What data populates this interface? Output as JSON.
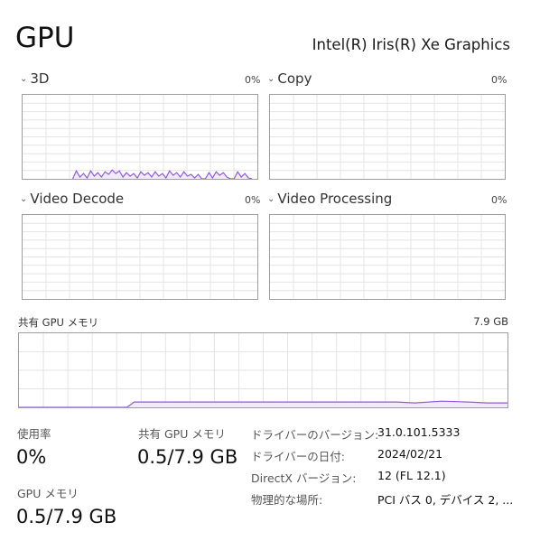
{
  "header": {
    "title": "GPU",
    "adapter": "Intel(R) Iris(R) Xe Graphics"
  },
  "engines": [
    {
      "label": "3D",
      "percent": "0%"
    },
    {
      "label": "Copy",
      "percent": "0%"
    },
    {
      "label": "Video Decode",
      "percent": "0%"
    },
    {
      "label": "Video Processing",
      "percent": "0%"
    }
  ],
  "shared_memory": {
    "label": "共有 GPU メモリ",
    "max": "7.9 GB"
  },
  "stats": {
    "utilization_label": "使用率",
    "utilization_value": "0%",
    "gpu_memory_label": "GPU メモリ",
    "gpu_memory_value": "0.5/7.9 GB",
    "shared_memory_label": "共有 GPU メモリ",
    "shared_memory_value": "0.5/7.9 GB"
  },
  "details": [
    {
      "label": "ドライバーのバージョン:",
      "value": "31.0.101.5333"
    },
    {
      "label": "ドライバーの日付:",
      "value": "2024/02/21"
    },
    {
      "label": "DirectX バージョン:",
      "value": "12 (FL 12.1)"
    },
    {
      "label": "物理的な場所:",
      "value": "PCI バス 0, デバイス 2, ..."
    }
  ],
  "colors": {
    "graph_line": "#8e5bd6",
    "graph_fill": "#f1eafb",
    "grid": "#e4e4e4",
    "border": "#9d9d9d"
  },
  "icons": {
    "expand": "chevron-down-icon"
  }
}
